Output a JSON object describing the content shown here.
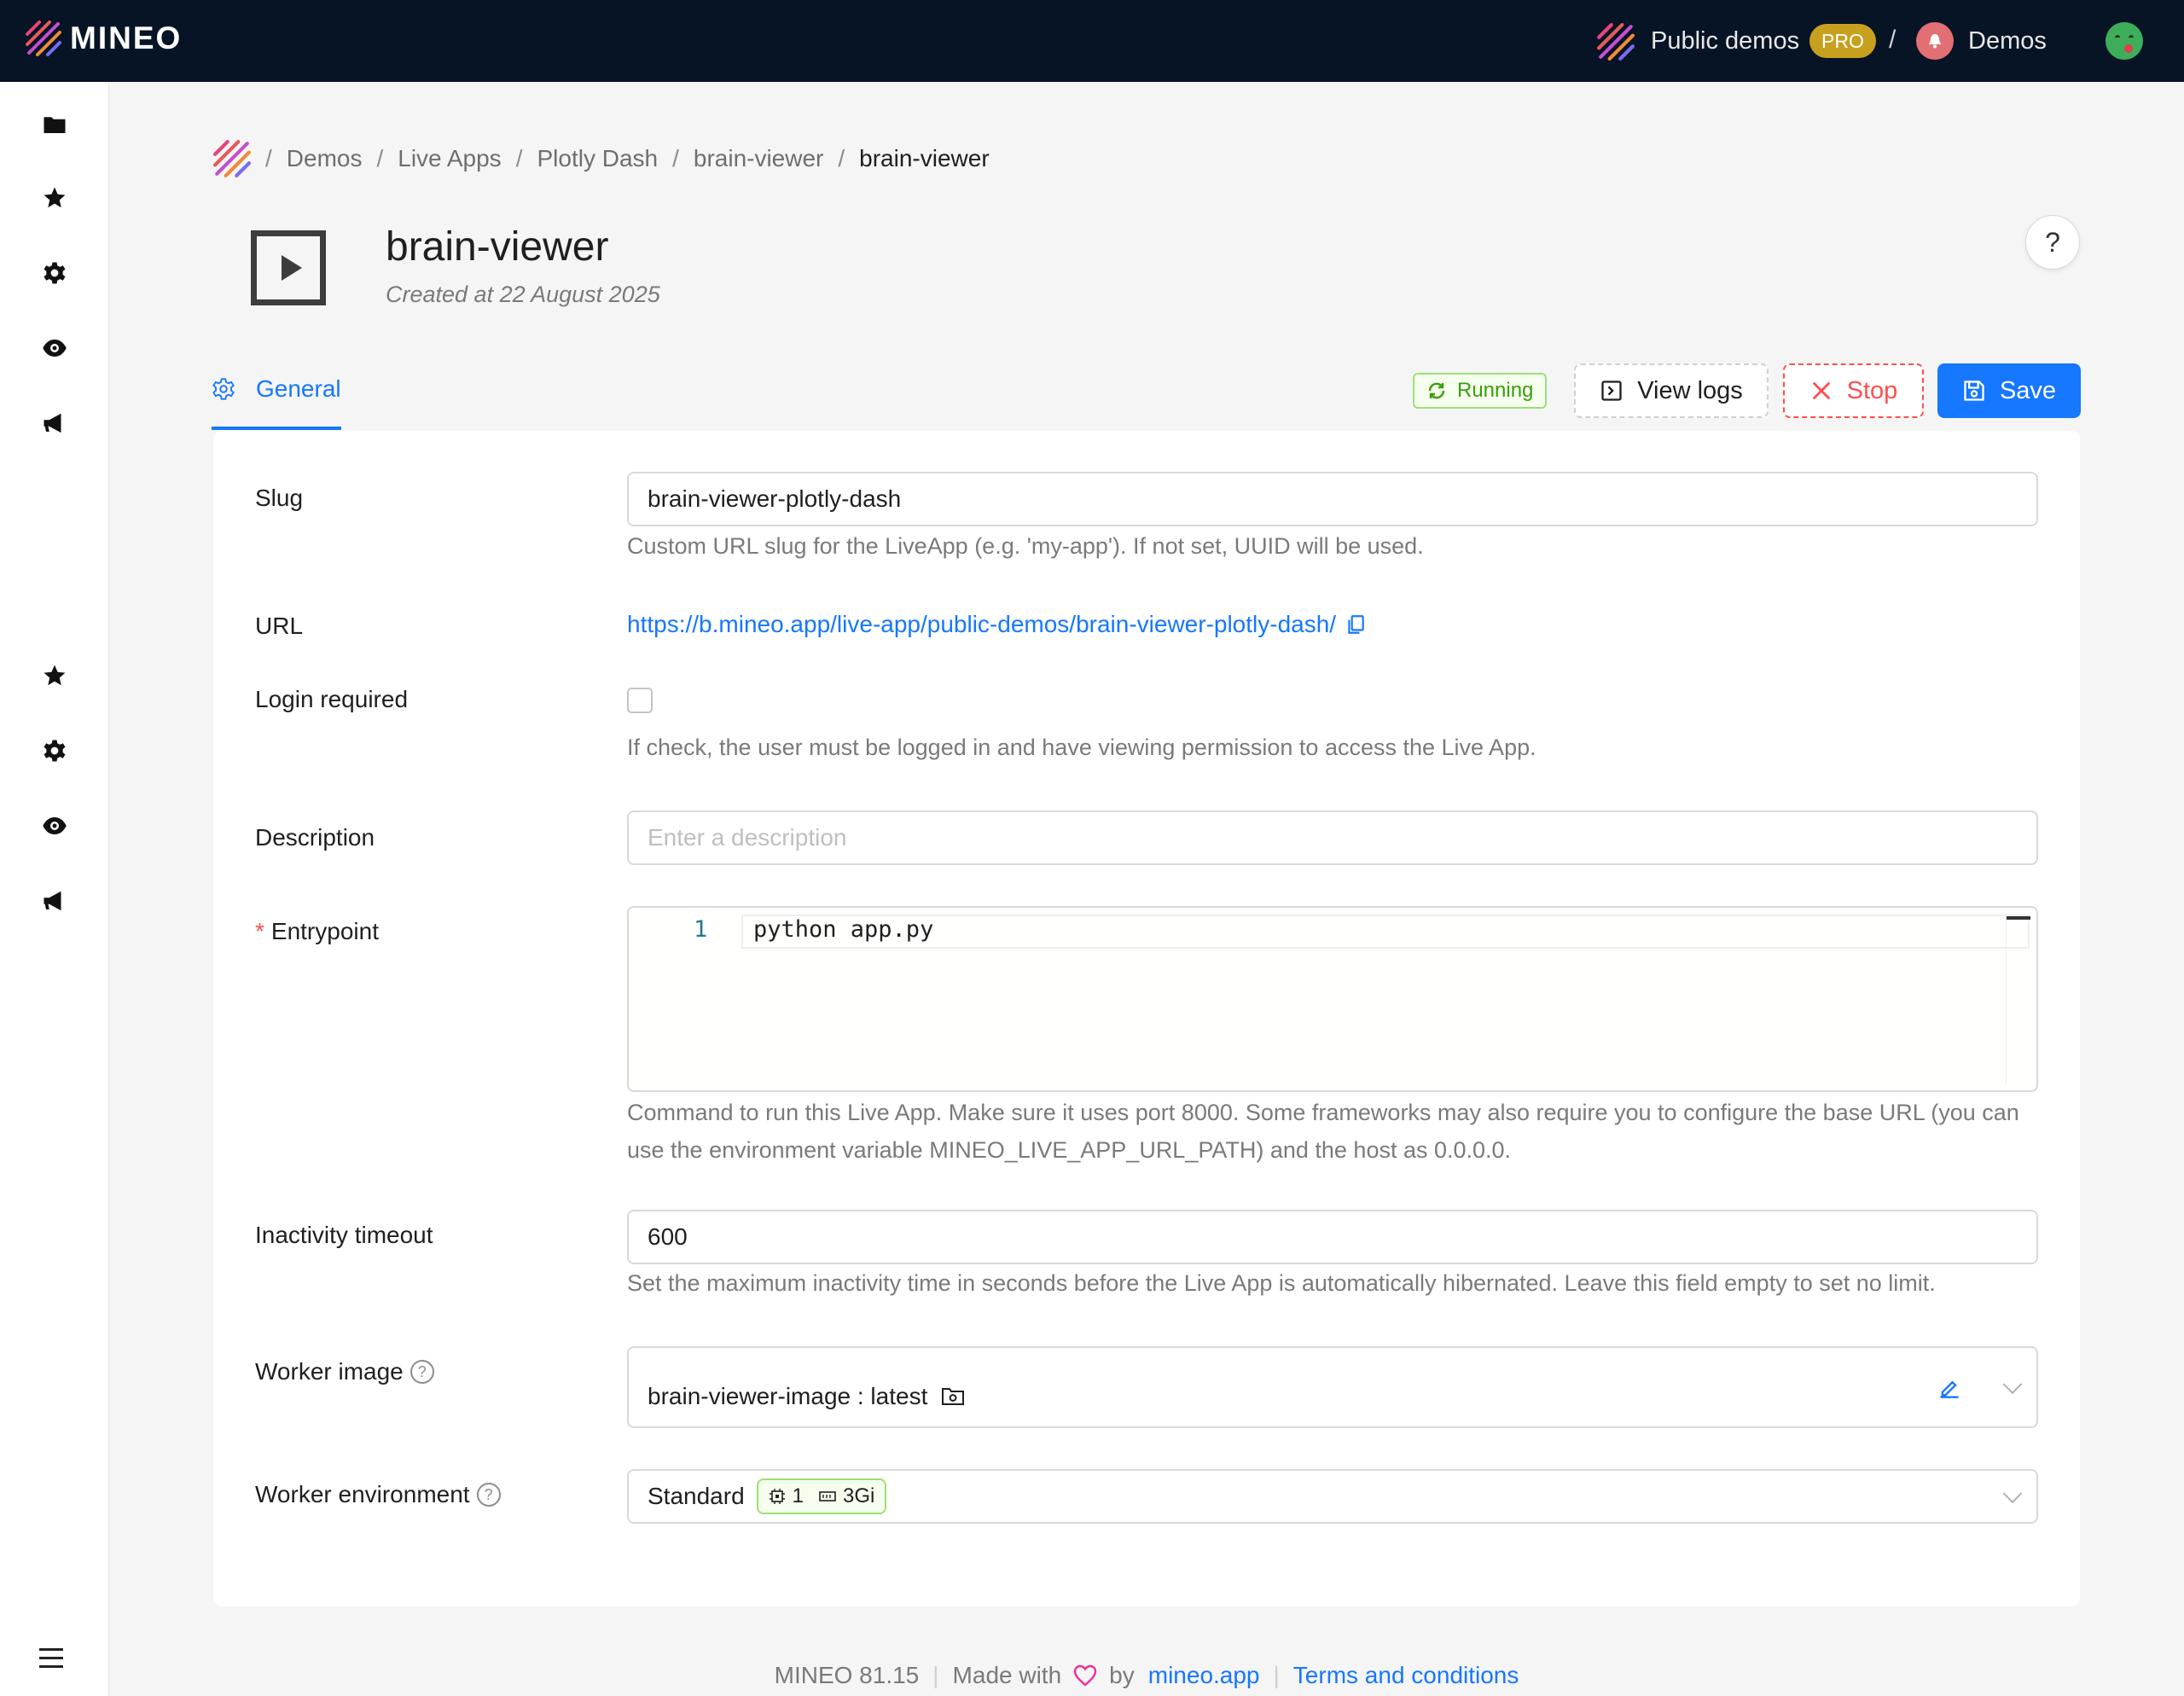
{
  "brand": {
    "name": "MINEO"
  },
  "topbar": {
    "workspace": "Public demos",
    "badge": "PRO",
    "separator": "/",
    "project": "Demos"
  },
  "breadcrumb": [
    "Demos",
    "Live Apps",
    "Plotly Dash",
    "brain-viewer",
    "brain-viewer"
  ],
  "header": {
    "title": "brain-viewer",
    "created": "Created at 22 August 2025",
    "help": "?"
  },
  "tabs": {
    "general": "General"
  },
  "actions": {
    "status": "Running",
    "view_logs": "View logs",
    "stop": "Stop",
    "save": "Save"
  },
  "form": {
    "slug": {
      "label": "Slug",
      "value": "brain-viewer-plotly-dash",
      "help": "Custom URL slug for the LiveApp (e.g. 'my-app'). If not set, UUID will be used."
    },
    "url": {
      "label": "URL",
      "value": "https://b.mineo.app/live-app/public-demos/brain-viewer-plotly-dash/"
    },
    "login": {
      "label": "Login required",
      "checked": false,
      "help": "If check, the user must be logged in and have viewing permission to access the Live App."
    },
    "description": {
      "label": "Description",
      "placeholder": "Enter a description",
      "value": ""
    },
    "entrypoint": {
      "required_mark": "*",
      "label": "Entrypoint",
      "line_number": "1",
      "code": "python app.py",
      "help": "Command to run this Live App. Make sure it uses port 8000. Some frameworks may also require you to configure the base URL (you can use the environment variable MINEO_LIVE_APP_URL_PATH) and the host as 0.0.0.0."
    },
    "timeout": {
      "label": "Inactivity timeout",
      "value": "600",
      "help": "Set the maximum inactivity time in seconds before the Live App is automatically hibernated. Leave this field empty to set no limit."
    },
    "worker_image": {
      "label": "Worker image",
      "value": "brain-viewer-image : latest"
    },
    "worker_env": {
      "label": "Worker environment",
      "value": "Standard",
      "cpu": "1",
      "memory": "3Gi"
    }
  },
  "footer": {
    "version": "MINEO 81.15",
    "made_with": "Made with",
    "by": "by",
    "site": "mineo.app",
    "terms": "Terms and conditions"
  },
  "colors": {
    "topbar_bg": "#071426",
    "accent": "#1677ff",
    "danger": "#ff4d4f",
    "success": "#389e0d",
    "pro_badge": "#c8a020"
  }
}
